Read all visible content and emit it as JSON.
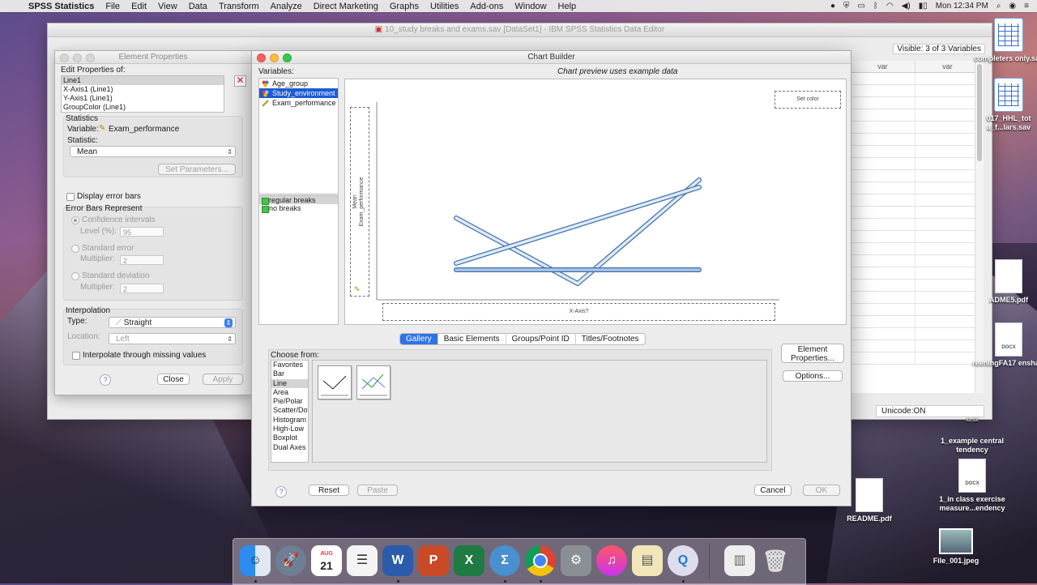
{
  "menubar": {
    "app": "SPSS Statistics",
    "items": [
      "File",
      "Edit",
      "View",
      "Data",
      "Transform",
      "Analyze",
      "Direct Marketing",
      "Graphs",
      "Utilities",
      "Add-ons",
      "Window",
      "Help"
    ],
    "clock": "Mon 12:34 PM"
  },
  "editor": {
    "title": "10_study breaks and exams.sav [DataSet1] - IBM SPSS Statistics Data Editor",
    "visible": "Visible: 3 of 3 Variables",
    "col_headers": [
      "var",
      "var"
    ],
    "status_unicode": "Unicode:ON"
  },
  "element_properties": {
    "title": "Element Properties",
    "edit_label": "Edit Properties of:",
    "elements": [
      "Line1",
      "X-Axis1 (Line1)",
      "Y-Axis1 (Line1)",
      "GroupColor (Line1)"
    ],
    "statistics_heading": "Statistics",
    "variable_label": "Variable:",
    "variable_value": "Exam_performance",
    "statistic_label": "Statistic:",
    "statistic_value": "Mean",
    "set_parameters": "Set Parameters...",
    "display_error_bars": "Display error bars",
    "error_bars_heading": "Error Bars Represent",
    "confidence_intervals": "Confidence intervals",
    "level_label": "Level (%):",
    "level_value": "95",
    "standard_error": "Standard error",
    "multiplier_label": "Multiplier:",
    "multiplier_se": "2",
    "standard_deviation": "Standard deviation",
    "multiplier_sd": "2",
    "interpolation_heading": "Interpolation",
    "type_label": "Type:",
    "type_value": "Straight",
    "location_label": "Location:",
    "location_value": "Left",
    "interpolate_missing": "Interpolate through missing values",
    "close": "Close",
    "apply": "Apply",
    "help": "?"
  },
  "chart_builder": {
    "title": "Chart Builder",
    "variables_label": "Variables:",
    "preview_note": "Chart preview uses example data",
    "variables": [
      {
        "name": "Age_group",
        "icon": "nominal-icon",
        "selected": false
      },
      {
        "name": "Study_environment",
        "icon": "nominal-icon",
        "selected": true
      },
      {
        "name": "Exam_performance",
        "icon": "scale-ruler-icon",
        "selected": false
      }
    ],
    "categories": [
      {
        "name": "regular breaks",
        "selected": true
      },
      {
        "name": "no breaks",
        "selected": false
      }
    ],
    "preview": {
      "set_color": "Set color",
      "y_axis_label_top": "Mean",
      "y_axis_label_bottom": "Exam_performance",
      "x_axis": "X-Axis?"
    },
    "tabs": [
      {
        "label": "Gallery",
        "active": true
      },
      {
        "label": "Basic Elements",
        "active": false
      },
      {
        "label": "Groups/Point ID",
        "active": false
      },
      {
        "label": "Titles/Footnotes",
        "active": false
      }
    ],
    "choose_from_label": "Choose from:",
    "chart_types": [
      "Favorites",
      "Bar",
      "Line",
      "Area",
      "Pie/Polar",
      "Scatter/Dot",
      "Histogram",
      "High-Low",
      "Boxplot",
      "Dual Axes"
    ],
    "selected_chart_type": "Line",
    "element_properties_button": "Element Properties...",
    "options_button": "Options...",
    "reset": "Reset",
    "paste": "Paste",
    "cancel": "Cancel",
    "ok": "OK",
    "help": "?"
  },
  "desktop_icons": [
    {
      "label": "completers only.sav"
    },
    {
      "label": "017_HHL_tot a_f...lars.sav"
    },
    {
      "label": "ADME5.pdf"
    },
    {
      "label": "reeningFA17 enshaw"
    },
    {
      "label": "XLSX"
    },
    {
      "label": "1_example central tendency"
    },
    {
      "label": "DOCX"
    },
    {
      "label": "1_in class exercise measure...endency"
    },
    {
      "label": "README.pdf"
    },
    {
      "label": "File_001.jpeg"
    }
  ],
  "dock": {
    "calendar_month": "AUG",
    "calendar_day": "21"
  },
  "colors": {
    "accent": "#2f73e6",
    "selection": "#1f5bd3",
    "category_swatch": "#49c24b",
    "line_preview": "#7fa9d6"
  }
}
